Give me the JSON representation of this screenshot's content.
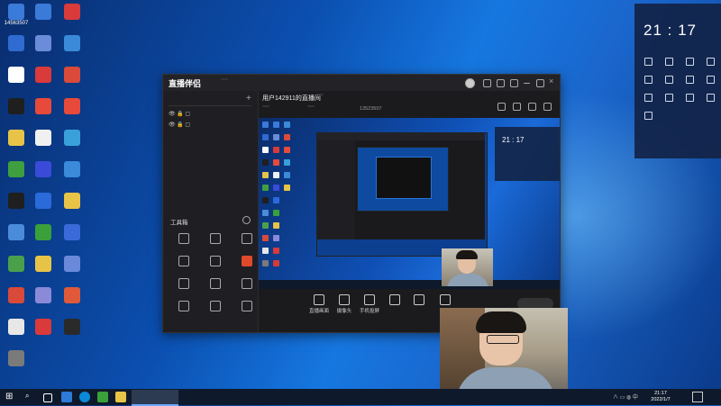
{
  "desktop": {
    "icons": [
      {
        "label": "14563507",
        "color": "#3a7ad9"
      },
      {
        "label": "",
        "color": "#2f6bd0"
      },
      {
        "label": "",
        "color": "#ffffff"
      },
      {
        "label": "",
        "color": "#1f1f1f"
      },
      {
        "label": "",
        "color": "#e7c447"
      },
      {
        "label": "",
        "color": "#3f9f3f"
      },
      {
        "label": "",
        "color": "#1f1f1f"
      },
      {
        "label": "",
        "color": "#4a8cd9"
      },
      {
        "label": "",
        "color": "#4aa04a"
      },
      {
        "label": "",
        "color": "#d94a3a"
      },
      {
        "label": "",
        "color": "#e7e7e7"
      },
      {
        "label": "",
        "color": "#7a7a7a"
      },
      {
        "label": "",
        "color": "#3a7ad9"
      },
      {
        "label": "",
        "color": "#6a8cd9"
      },
      {
        "label": "",
        "color": "#d93a3a"
      },
      {
        "label": "",
        "color": "#e74a3a"
      },
      {
        "label": "",
        "color": "#f0f0f0"
      },
      {
        "label": "",
        "color": "#3a4ad9"
      },
      {
        "label": "",
        "color": "#2a6ad9"
      },
      {
        "label": "",
        "color": "#3aa03a"
      },
      {
        "label": "",
        "color": "#e7c447"
      },
      {
        "label": "",
        "color": "#8a8ad9"
      },
      {
        "label": "",
        "color": "#d93a3a"
      },
      {
        "label": "",
        "color": "#d93a3a"
      },
      {
        "label": "",
        "color": "#3a8ad9"
      },
      {
        "label": "",
        "color": "#d94a3a"
      },
      {
        "label": "",
        "color": "#e74a3a"
      },
      {
        "label": "",
        "color": "#3aa0d9"
      },
      {
        "label": "",
        "color": "#3a8ad9"
      },
      {
        "label": "",
        "color": "#e7c447"
      },
      {
        "label": "",
        "color": "#3a6ad9"
      },
      {
        "label": "",
        "color": "#6a8ad9"
      },
      {
        "label": "",
        "color": "#e05a3a"
      },
      {
        "label": "",
        "color": "#2a2a2a"
      }
    ]
  },
  "app": {
    "title": "直播伴侣",
    "version_badge": "",
    "tabs": [
      "",
      "",
      ""
    ],
    "scenes": [
      "",
      ""
    ],
    "tools_title": "工具箱",
    "tools": [
      {
        "label": ""
      },
      {
        "label": ""
      },
      {
        "label": ""
      },
      {
        "label": ""
      },
      {
        "label": ""
      },
      {
        "label": ""
      },
      {
        "label": ""
      },
      {
        "label": ""
      },
      {
        "label": ""
      },
      {
        "label": ""
      },
      {
        "label": ""
      },
      {
        "label": ""
      }
    ],
    "status_text": "",
    "header": {
      "room_title": "用户142911的直播间",
      "edit": "",
      "tag1": "",
      "tag2": "",
      "uid": "13523507",
      "hot": ""
    },
    "controls": [
      {
        "label": "直播画面"
      },
      {
        "label": "摄像头"
      },
      {
        "label": "手机投屏"
      },
      {
        "label": ""
      },
      {
        "label": ""
      },
      {
        "label": ""
      }
    ],
    "go_live": ""
  },
  "right_panel": {
    "header": "",
    "time": "21 : 17",
    "date": "",
    "icons": [
      {
        "label": ""
      },
      {
        "label": ""
      },
      {
        "label": ""
      },
      {
        "label": ""
      },
      {
        "label": ""
      },
      {
        "label": ""
      },
      {
        "label": ""
      },
      {
        "label": ""
      },
      {
        "label": ""
      },
      {
        "label": ""
      },
      {
        "label": ""
      },
      {
        "label": ""
      },
      {
        "label": ""
      }
    ],
    "line1": "",
    "line2": ""
  },
  "taskbar": {
    "app_label": "",
    "clock_time": "21:17",
    "clock_date": "2022/1/7"
  }
}
